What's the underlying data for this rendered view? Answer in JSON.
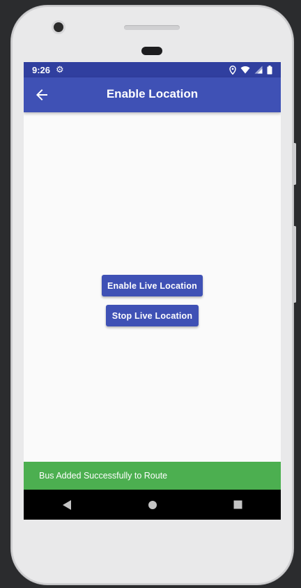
{
  "status_bar": {
    "time": "9:26",
    "icons": [
      "gear-icon",
      "location-pin-icon",
      "wifi-icon",
      "signal-icon",
      "battery-icon"
    ]
  },
  "app_bar": {
    "title": "Enable Location",
    "back_icon": "arrow-back-icon"
  },
  "buttons": {
    "enable_label": "Enable Live Location",
    "stop_label": "Stop Live Location"
  },
  "snackbar": {
    "message": "Bus Added Successfully to Route"
  },
  "nav_bar": {
    "icons": [
      "back-triangle-icon",
      "home-circle-icon",
      "recents-square-icon"
    ]
  },
  "colors": {
    "primary": "#3f51b5",
    "primary_dark": "#303f9f",
    "success": "#4caf50",
    "background": "#fafafa"
  }
}
